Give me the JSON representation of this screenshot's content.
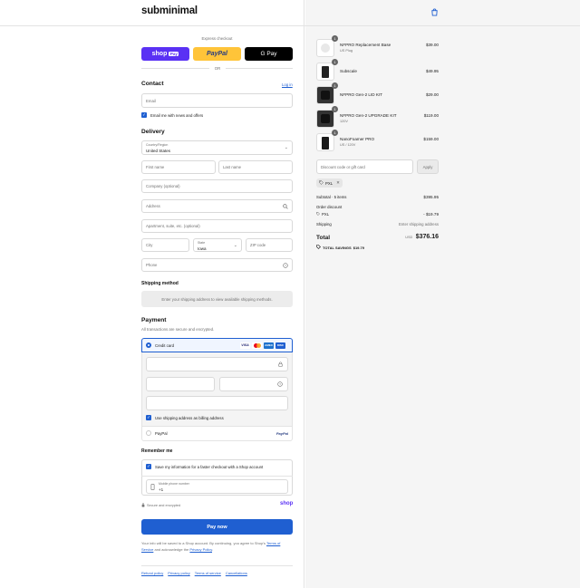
{
  "header": {
    "logo": "subminimal",
    "bag_icon": "shopping-bag-icon"
  },
  "express": {
    "label": "Express checkout",
    "shop_pay": "shop",
    "shop_pay_badge": "Pay",
    "paypal": "PayPal",
    "gpay": "G Pay",
    "or": "OR"
  },
  "contact": {
    "heading": "Contact",
    "login": "Log in",
    "email_placeholder": "Email",
    "newsletter_label": "Email me with news and offers"
  },
  "delivery": {
    "heading": "Delivery",
    "country_label": "Country/Region",
    "country_value": "United States",
    "first_name": "First name",
    "last_name": "Last name",
    "company": "Company (optional)",
    "address": "Address",
    "apartment": "Apartment, suite, etc. (optional)",
    "city": "City",
    "state_label": "State",
    "state_value": "Iowa",
    "zip": "ZIP code",
    "phone": "Phone"
  },
  "shipping_method": {
    "heading": "Shipping method",
    "notice": "Enter your shipping address to view available shipping methods."
  },
  "payment": {
    "heading": "Payment",
    "subtitle": "All transactions are secure and encrypted.",
    "credit_card": "Credit card",
    "card_brands": [
      "VISA",
      "MC",
      "AMEX",
      "DISC"
    ],
    "billing_label": "Use shipping address as billing address",
    "paypal": "PayPal",
    "paypal_logo": "PayPal"
  },
  "remember": {
    "heading": "Remember me",
    "save_label": "Save my information for a faster checkout with a Shop account",
    "mobile_label": "Mobile phone number",
    "mobile_value": "+1",
    "secure": "Secure and encrypted",
    "shop_logo": "shop"
  },
  "pay_button": "Pay now",
  "legal": {
    "text1": "Your info will be saved to a Shop account. By continuing, you agree to Shop's",
    "terms": "Terms of Service",
    "text2": "and acknowledge the",
    "privacy": "Privacy Policy",
    "text3": "."
  },
  "footer_links": [
    "Refund policy",
    "Privacy policy",
    "Terms of service",
    "Cancellations"
  ],
  "cart": {
    "items": [
      {
        "qty": "1",
        "name": "NFPRO Replacement Base",
        "variant": "US Plug",
        "price": "$39.00"
      },
      {
        "qty": "1",
        "name": "Subscale",
        "variant": "",
        "price": "$49.95"
      },
      {
        "qty": "1",
        "name": "NFPRO Gen-2 LID KIT",
        "variant": "",
        "price": "$29.00"
      },
      {
        "qty": "1",
        "name": "NFPRO Gen-2 UPGRADE KIT",
        "variant": "120V",
        "price": "$119.00"
      },
      {
        "qty": "1",
        "name": "NanoFoamer PRO",
        "variant": "US / 120V",
        "price": "$159.00"
      }
    ],
    "discount_placeholder": "Discount code or gift card",
    "apply": "Apply",
    "code_tag": "PXL",
    "subtotal_label": "Subtotal · 5 items",
    "subtotal": "$395.95",
    "order_discount": "Order discount",
    "discount_code": "PXL",
    "discount_amount": "- $19.79",
    "shipping_label": "Shipping",
    "shipping_value": "Enter shipping address",
    "total_label": "Total",
    "currency": "USD",
    "total": "$376.16",
    "savings_label": "TOTAL SAVINGS",
    "savings": "$19.79"
  }
}
